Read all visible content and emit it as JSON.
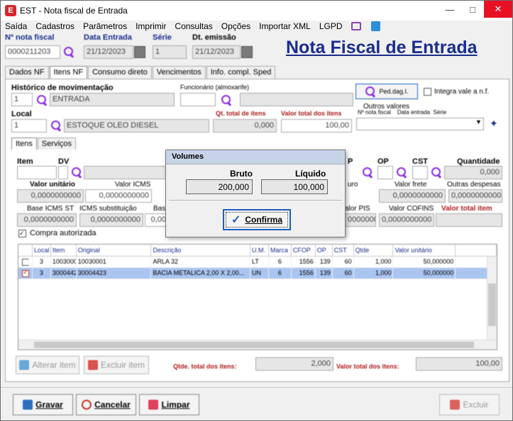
{
  "window": {
    "title": "EST - Nota fiscal de Entrada",
    "app_icon": "EST"
  },
  "menu": [
    "Saída",
    "Cadastros",
    "Parâmetros",
    "Imprimir",
    "Consultas",
    "Opções",
    "Importar XML",
    "LGPD"
  ],
  "header": {
    "nota_label": "Nº nota fiscal",
    "nota_value": "0000211203",
    "data_entrada_label": "Data Entrada",
    "data_entrada_value": "21/12/2023",
    "serie_label": "Série",
    "serie_value": "1",
    "emissao_label": "Dt. emissão",
    "emissao_value": "21/12/2023",
    "page_title": "Nota Fiscal de Entrada"
  },
  "tabs": [
    "Dados NF",
    "Itens NF",
    "Consumo direto",
    "Vencimentos",
    "Info. compl. Sped"
  ],
  "panel": {
    "historico_label": "Histórico de movimentação",
    "historico_code": "1",
    "historico_value": "ENTRADA",
    "funcionario_label": "Funcionário (almoxarife)",
    "ped_btn": "Ped.dag.I.",
    "integra_label": "Integra vale a n.f.",
    "outros_label": "Outros valores",
    "outros_cols": "Nº nota fiscal    Data entrada  Série",
    "local_label": "Local",
    "local_code": "1",
    "local_value": "ESTOQUE OLEO DIESEL",
    "qt_total_label": "Qt. total de itens",
    "qt_total_value": "0,000",
    "valor_total_label": "Valor total dos itens",
    "valor_total_value": "100,00",
    "subtabs": [
      "Itens",
      "Serviços"
    ],
    "item_label": "Item",
    "dv_label": "DV",
    "p_label": "P",
    "op_label": "OP",
    "cst_label": "CST",
    "quantidade_label": "Quantidade",
    "quantidade_value": "0,000",
    "valor_unitario_label": "Valor unitário",
    "valor_unitario_value": "0,0000000000",
    "valor_icms_label": "Valor ICMS",
    "valor_icms_value": "0,0000000000",
    "seguro_label": "uro",
    "valor_frete_label": "Valor frete",
    "valor_frete_value": "0,0000000000",
    "outras_label": "Outras despesas",
    "outras_value": "0,0000000000",
    "base_st_label": "Base ICMS ST",
    "base_st_value": "0,0000000000",
    "icms_sub_label": "ICMS substituição",
    "icms_sub_value": "0,0000000000",
    "base_label": "Base",
    "base_value": "0,00",
    "pis_label": "alor PIS",
    "pis_value": "0000000",
    "cofins_label": "Valor COFINS",
    "cofins_value": "0,0000000000",
    "total_item_label": "Valor total item",
    "compra_label": "Compra autorizada"
  },
  "grid": {
    "headers": [
      "",
      "Local",
      "Item",
      "Original",
      "Descrição",
      "U.M.",
      "Marca",
      "CFOP",
      "OP",
      "CST",
      "Qtde",
      "Valor unitário",
      ""
    ],
    "rows": [
      {
        "checked": false,
        "cells": [
          "3",
          "10030001",
          "10030001",
          "ARLA 32",
          "LT",
          "6",
          "1556",
          "139",
          "60",
          "1,000",
          "50,000000",
          ""
        ]
      },
      {
        "checked": true,
        "cells": [
          "3",
          "30004423",
          "30004423",
          "BACIA METALICA 2,00 X 2,00...",
          "UN",
          "6",
          "1556",
          "139",
          "60",
          "1,000",
          "50,000000",
          ""
        ]
      }
    ]
  },
  "grid_actions": {
    "alterar": "Alterar item",
    "excluir": "Excluir item",
    "qtde_total_label": "Qtde. total dos itens:",
    "qtde_total_value": "2,000",
    "valor_itens_label": "Valor total dos itens:",
    "valor_itens_value": "100,00"
  },
  "footer": {
    "gravar": "Gravar",
    "cancelar": "Cancelar",
    "limpar": "Limpar",
    "excluir": "Excluir"
  },
  "dialog": {
    "title": "Volumes",
    "bruto_label": "Bruto",
    "bruto_value": "200,000",
    "liquido_label": "Líquido",
    "liquido_value": "100,000",
    "confirm": "Confirma"
  }
}
